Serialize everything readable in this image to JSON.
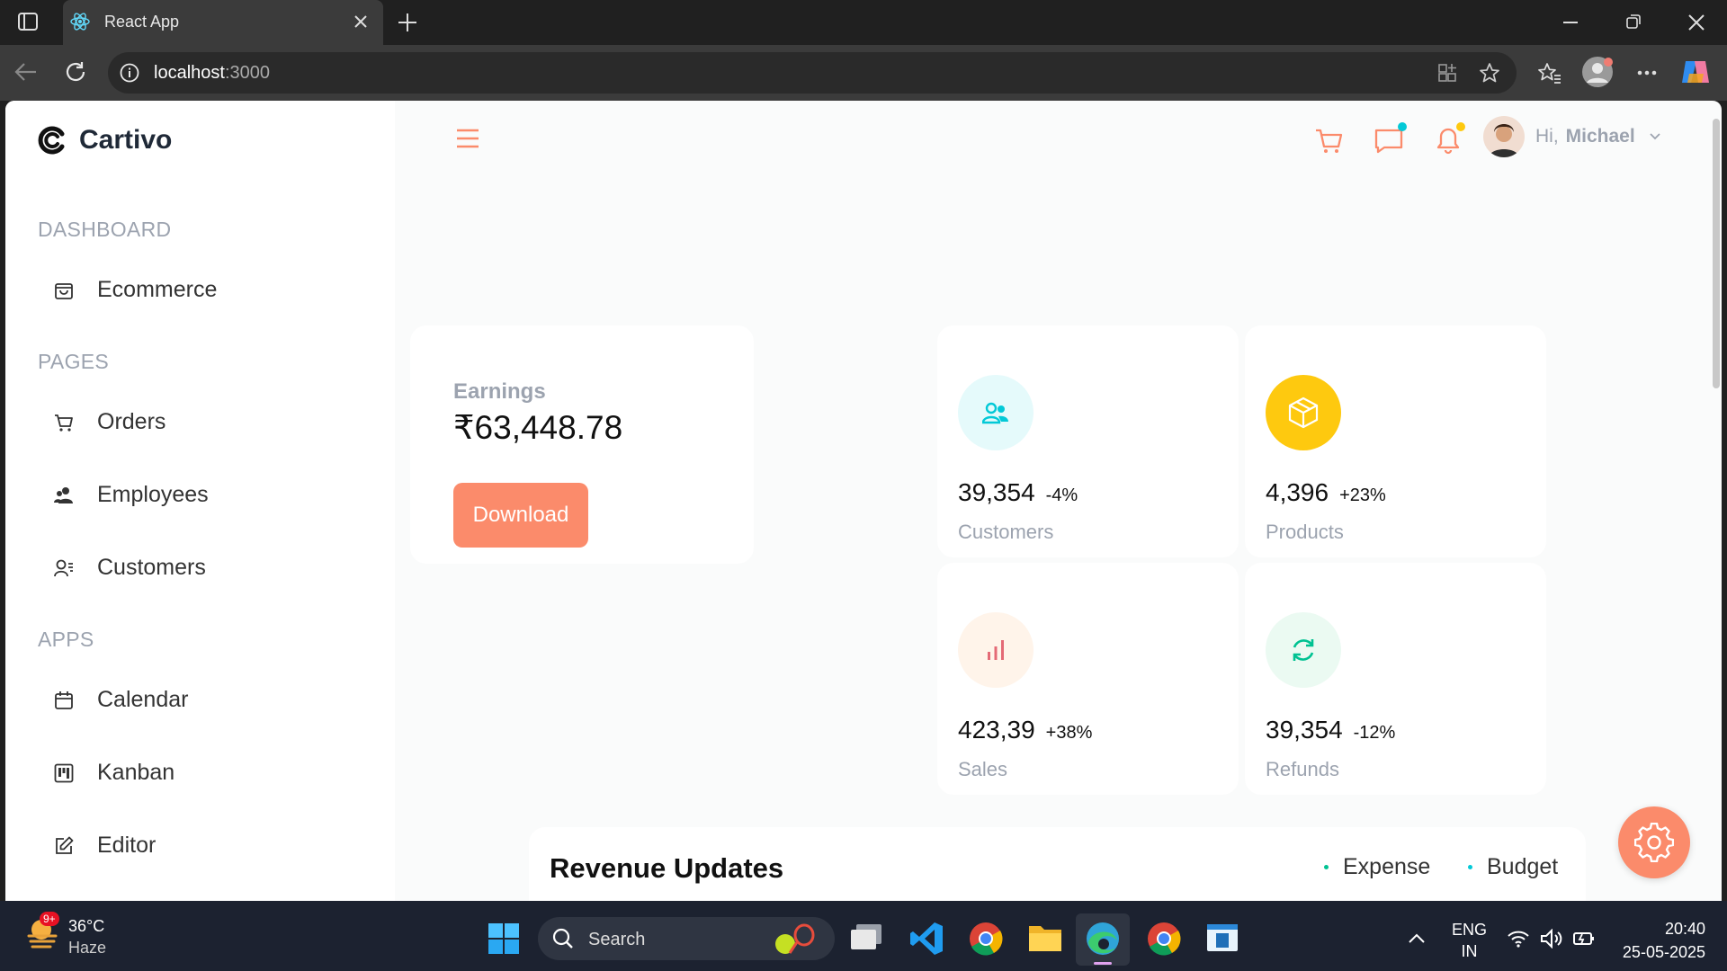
{
  "browser": {
    "tab_title": "React App",
    "url_host": "localhost",
    "url_port": ":3000"
  },
  "brand": {
    "name": "Cartivo"
  },
  "sidebar": {
    "sections": [
      {
        "title": "DASHBOARD",
        "items": [
          {
            "label": "Ecommerce",
            "icon": "shopping-bag-icon"
          }
        ]
      },
      {
        "title": "PAGES",
        "items": [
          {
            "label": "Orders",
            "icon": "cart-icon"
          },
          {
            "label": "Employees",
            "icon": "employees-icon"
          },
          {
            "label": "Customers",
            "icon": "customers-icon"
          }
        ]
      },
      {
        "title": "APPS",
        "items": [
          {
            "label": "Calendar",
            "icon": "calendar-icon"
          },
          {
            "label": "Kanban",
            "icon": "kanban-icon"
          },
          {
            "label": "Editor",
            "icon": "edit-icon"
          }
        ]
      }
    ]
  },
  "header": {
    "greeting": "Hi,",
    "user_name": "Michael",
    "accent_color": "#fb8b6b"
  },
  "earnings": {
    "title": "Earnings",
    "amount": "₹63,448.78",
    "button": "Download"
  },
  "stats": [
    {
      "value": "39,354",
      "change": "-4%",
      "label": "Customers",
      "icon": "users-icon",
      "icon_color": "#03c9d7",
      "bg": "#e5fafb"
    },
    {
      "value": "4,396",
      "change": "+23%",
      "label": "Products",
      "icon": "box-icon",
      "icon_color": "#ffffff",
      "bg": "#fec90f"
    },
    {
      "value": "423,39",
      "change": "+38%",
      "label": "Sales",
      "icon": "bar-chart-icon",
      "icon_color": "#e46a76",
      "bg": "#fff4ea"
    },
    {
      "value": "39,354",
      "change": "-12%",
      "label": "Refunds",
      "icon": "refresh-icon",
      "icon_color": "#00c292",
      "bg": "#ebfaf2"
    }
  ],
  "revenue": {
    "title": "Revenue Updates",
    "legend": [
      {
        "label": "Expense",
        "color": "#00c292"
      },
      {
        "label": "Budget",
        "color": "#03c9d7"
      }
    ]
  },
  "taskbar": {
    "weather_temp": "36°C",
    "weather_desc": "Haze",
    "weather_badge": "9+",
    "search_placeholder": "Search",
    "lang_top": "ENG",
    "lang_bottom": "IN",
    "time": "20:40",
    "date": "25-05-2025"
  }
}
